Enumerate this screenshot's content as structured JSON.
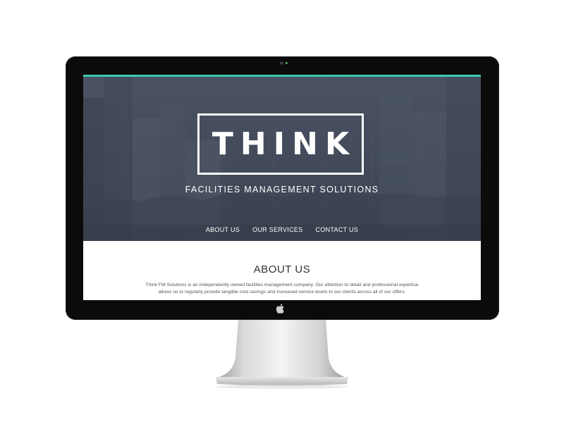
{
  "colors": {
    "accent": "#3ecbad",
    "hero_bg": "#464e5f",
    "monitor_bezel": "#0b0b0b"
  },
  "site": {
    "logo_text": "THINK",
    "tagline": "FACILITIES MANAGEMENT SOLUTIONS",
    "nav": [
      {
        "label": "ABOUT US"
      },
      {
        "label": "OUR SERVICES"
      },
      {
        "label": "CONTACT US"
      }
    ]
  },
  "about": {
    "title": "ABOUT US",
    "paragraph": "Think FM Solutions is an independently owned facilities management company. Our attention to detail and professional expertise allows us to regularly provide tangible cost savings and increased service levels to our clients across all of our offers."
  },
  "icons": {
    "brand": "apple-icon",
    "camera": "camera-icon"
  }
}
